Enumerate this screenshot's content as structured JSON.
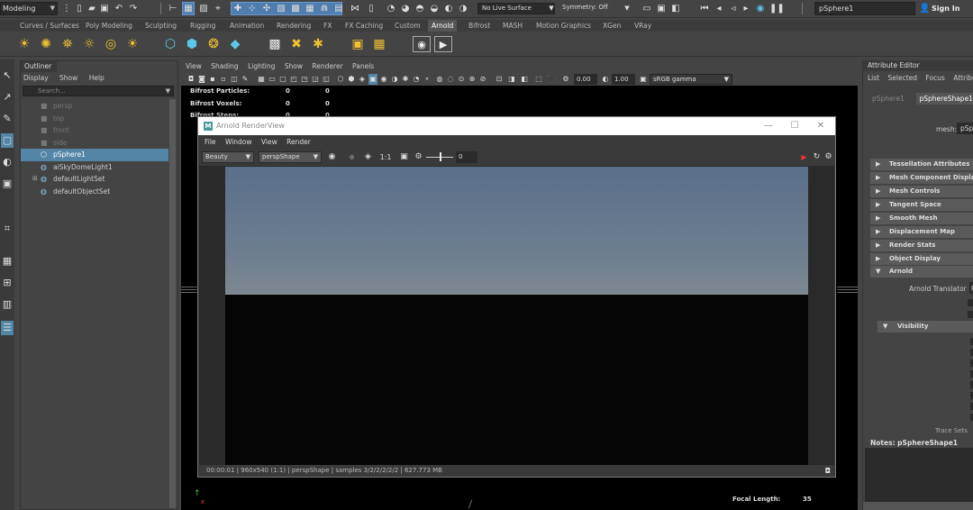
{
  "statusline": {
    "mode": "Modeling",
    "live_surface": "No Live Surface",
    "symmetry": "Symmetry: Off",
    "search_value": "pSphere1",
    "sign_in": "Sign In"
  },
  "shelf": {
    "tabs": [
      "Curves / Surfaces",
      "Poly Modeling",
      "Sculpting",
      "Rigging",
      "Animation",
      "Rendering",
      "FX",
      "FX Caching",
      "Custom",
      "Arnold",
      "Bifrost",
      "MASH",
      "Motion Graphics",
      "XGen",
      "VRay"
    ],
    "active_tab": "Arnold"
  },
  "outliner": {
    "title": "Outliner",
    "menu": [
      "Display",
      "Show",
      "Help"
    ],
    "search_placeholder": "Search...",
    "items": [
      {
        "label": "persp",
        "dim": true
      },
      {
        "label": "top",
        "dim": true
      },
      {
        "label": "front",
        "dim": true
      },
      {
        "label": "side",
        "dim": true
      },
      {
        "label": "pSphere1",
        "selected": true
      },
      {
        "label": "aiSkyDomeLight1"
      },
      {
        "label": "defaultLightSet"
      },
      {
        "label": "defaultObjectSet"
      }
    ]
  },
  "viewport": {
    "menu": [
      "View",
      "Shading",
      "Lighting",
      "Show",
      "Renderer",
      "Panels"
    ],
    "exposure": "0.00",
    "gamma": "1.00",
    "color_space": "sRGB gamma",
    "hud": [
      {
        "label": "Bifrost Particles:",
        "v1": "0",
        "v2": "0"
      },
      {
        "label": "Bifrost Voxels:",
        "v1": "0",
        "v2": "0"
      },
      {
        "label": "Bifrost Steps:",
        "v1": "0",
        "v2": "0"
      }
    ],
    "focal_label": "Focal Length:",
    "focal_value": "35"
  },
  "renderview": {
    "title": "Arnold RenderView",
    "logo": "M",
    "menu": [
      "File",
      "Window",
      "View",
      "Render"
    ],
    "aov": "Beauty",
    "camera": "perspShape",
    "ratio": "1:1",
    "exposure": "0",
    "status": "00:00:01 | 960x540 (1:1) | perspShape | samples 3/2/2/2/2/2 | 627.773 MB"
  },
  "attribute_editor": {
    "title": "Attribute Editor",
    "menu": [
      "List",
      "Selected",
      "Focus",
      "Attributes"
    ],
    "tabs": [
      "pSphere1",
      "pSphereShape1"
    ],
    "active_tab": "pSphereShape1",
    "mesh_label": "mesh:",
    "mesh_value": "pSp",
    "sections": [
      "Tessellation Attributes",
      "Mesh Component Display",
      "Mesh Controls",
      "Tangent Space",
      "Smooth Mesh",
      "Displacement Map",
      "Render Stats",
      "Object Display",
      "Arnold"
    ],
    "arnold_translator_label": "Arnold Translator",
    "arnold_translator_value": "p",
    "visibility_label": "Visibility",
    "trace_sets_label": "Trace Sets",
    "notes_label": "Notes:  pSphereShape1"
  }
}
